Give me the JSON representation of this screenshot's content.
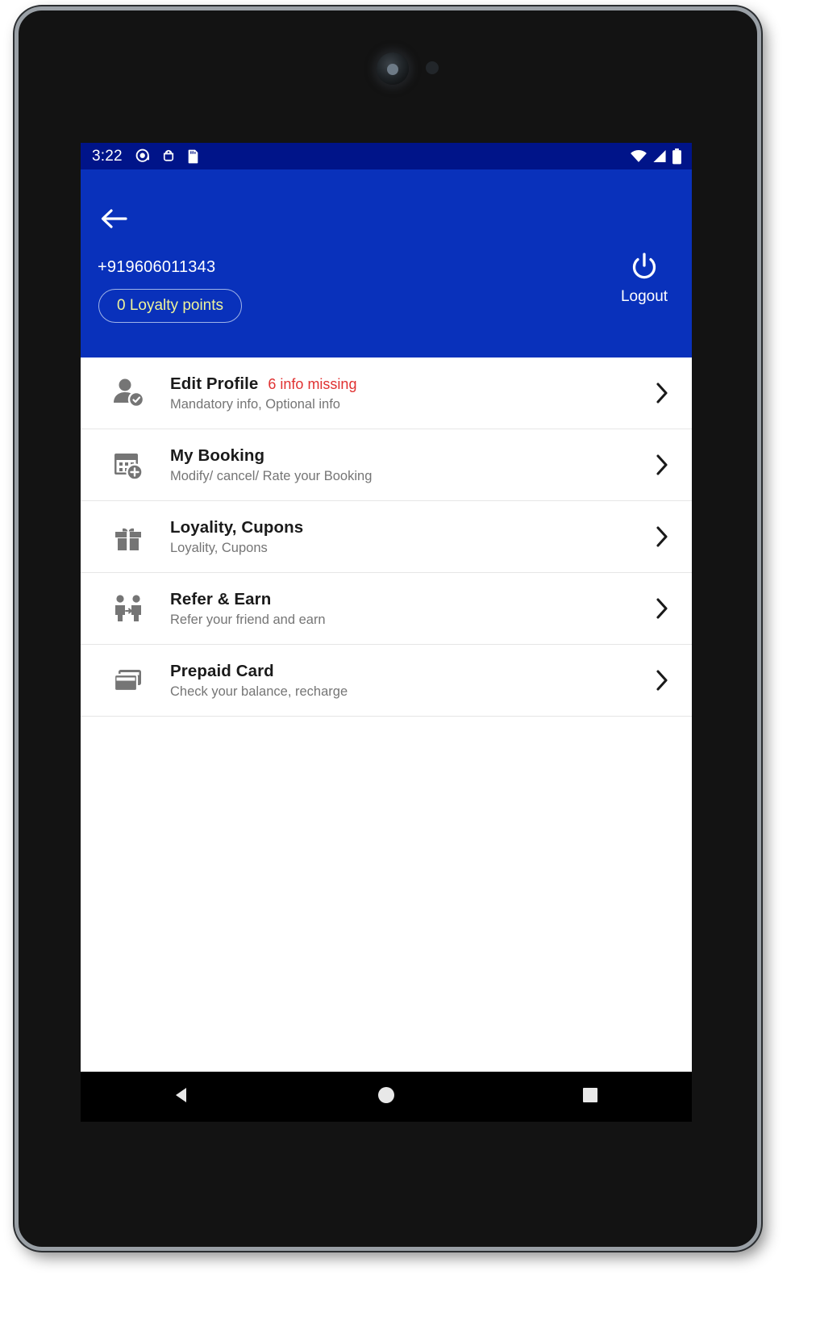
{
  "status_bar": {
    "clock": "3:22",
    "left_icons": [
      "message-icon",
      "android-debug-icon",
      "sd-card-icon"
    ],
    "right_icons": [
      "wifi-icon",
      "signal-icon",
      "battery-icon"
    ],
    "background_color": "#001489"
  },
  "header": {
    "background_color": "#0931bb",
    "back_icon": "arrow-back-icon",
    "phone_number": "+919606011343",
    "loyalty_chip_label": "0 Loyalty points",
    "loyalty_chip_text_color": "#eef39a",
    "logout_icon": "power-icon",
    "logout_label": "Logout"
  },
  "menu": {
    "items": [
      {
        "icon": "person-edit-icon",
        "title": "Edit Profile",
        "badge": "6 info missing",
        "badge_color": "#e03131",
        "subtitle": "Mandatory info, Optional info",
        "chevron": "chevron-right-icon"
      },
      {
        "icon": "calendar-booking-icon",
        "title": "My Booking",
        "badge": "",
        "subtitle": "Modify/ cancel/ Rate your Booking",
        "chevron": "chevron-right-icon"
      },
      {
        "icon": "gift-icon",
        "title": "Loyality, Cupons",
        "badge": "",
        "subtitle": "Loyality, Cupons",
        "chevron": "chevron-right-icon"
      },
      {
        "icon": "refer-friends-icon",
        "title": "Refer & Earn",
        "badge": "",
        "subtitle": "Refer your friend and earn",
        "chevron": "chevron-right-icon"
      },
      {
        "icon": "prepaid-card-icon",
        "title": "Prepaid Card",
        "badge": "",
        "subtitle": "Check your balance, recharge",
        "chevron": "chevron-right-icon"
      }
    ]
  },
  "nav_bar": {
    "back": "nav-back-triangle-icon",
    "home": "nav-home-circle-icon",
    "recents": "nav-recents-square-icon"
  }
}
